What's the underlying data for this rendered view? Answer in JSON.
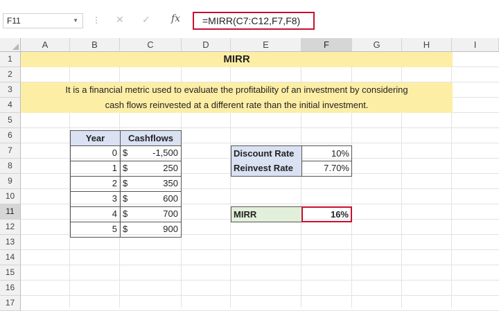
{
  "formula_bar": {
    "name_box": "F11",
    "fx_label": "fx",
    "formula": "=MIRR(C7:C12,F7,F8)"
  },
  "columns": [
    "A",
    "B",
    "C",
    "D",
    "E",
    "F",
    "G",
    "H",
    "I"
  ],
  "rows": [
    "1",
    "2",
    "3",
    "4",
    "5",
    "6",
    "7",
    "8",
    "9",
    "10",
    "11",
    "12",
    "13",
    "14",
    "15",
    "16",
    "17"
  ],
  "active_cell": {
    "column": "F",
    "row": "11"
  },
  "title": "MIRR",
  "description": {
    "line1": "It is a financial metric used to evaluate the profitability of an investment by considering",
    "line2": "cash flows reinvested at a different rate than the initial investment."
  },
  "table": {
    "headers": [
      "Year",
      "Cashflows"
    ],
    "currency": "$",
    "rows": [
      {
        "year": "0",
        "cashflow": "-1,500"
      },
      {
        "year": "1",
        "cashflow": "250"
      },
      {
        "year": "2",
        "cashflow": "350"
      },
      {
        "year": "3",
        "cashflow": "600"
      },
      {
        "year": "4",
        "cashflow": "700"
      },
      {
        "year": "5",
        "cashflow": "900"
      }
    ]
  },
  "rates": {
    "discount_label": "Discount Rate",
    "discount_value": "10%",
    "reinvest_label": "Reinvest Rate",
    "reinvest_value": "7.70%"
  },
  "result": {
    "label": "MIRR",
    "value": "16%"
  },
  "colors": {
    "banner": "#fdeea6",
    "header_fill": "#d9e1f2",
    "result_fill": "#e2efda",
    "highlight_border": "#c8102e"
  }
}
